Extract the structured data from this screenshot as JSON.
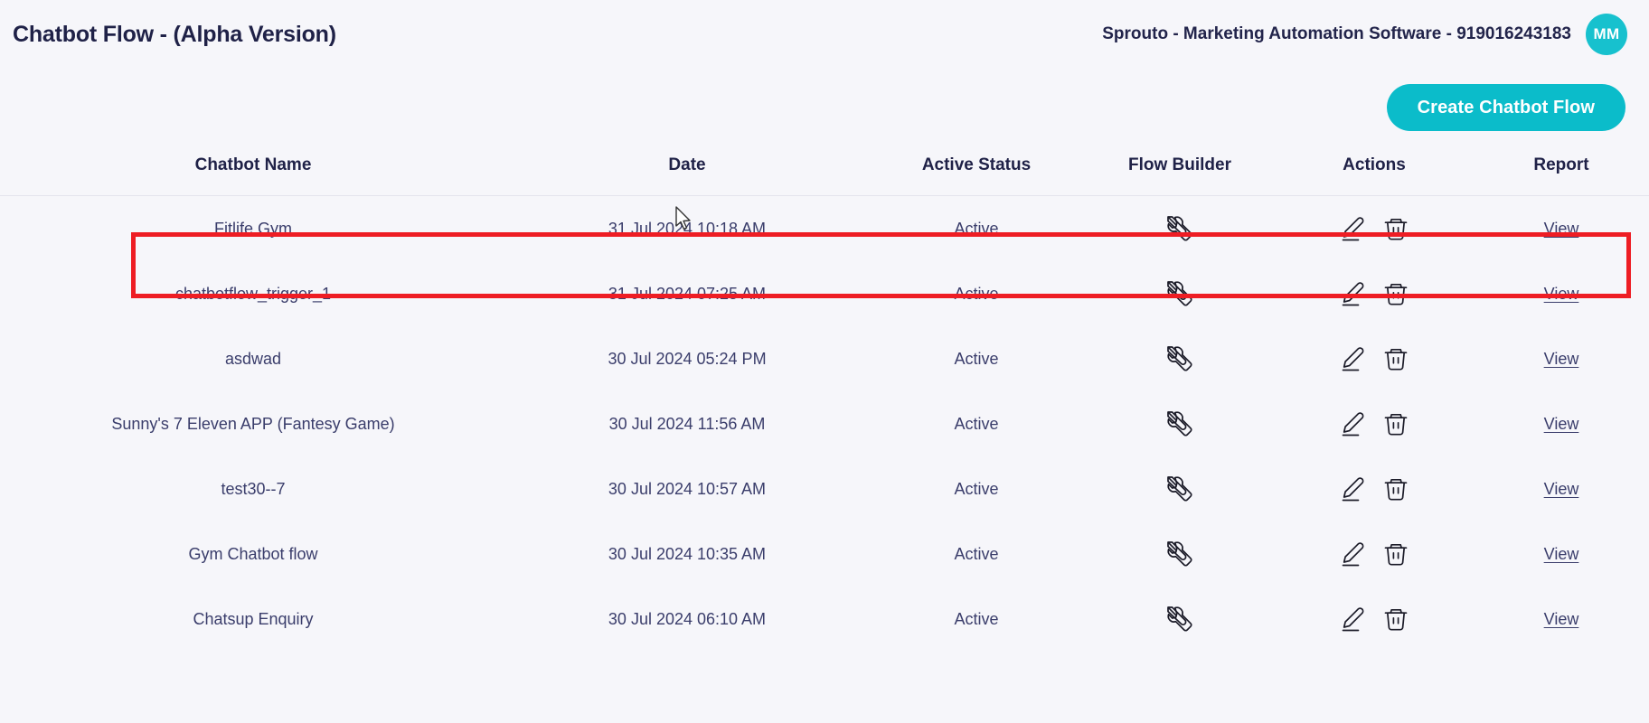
{
  "header": {
    "title": "Chatbot Flow - (Alpha Version)",
    "account_label": "Sprouto - Marketing Automation Software - 919016243183",
    "avatar_initials": "MM",
    "avatar_color": "#17c1ce"
  },
  "toolbar": {
    "create_label": "Create Chatbot Flow",
    "create_color": "#0bbcca"
  },
  "table": {
    "columns": [
      "Chatbot Name",
      "Date",
      "Active Status",
      "Flow Builder",
      "Actions",
      "Report"
    ],
    "icons": {
      "flow_builder": "tools-icon",
      "edit": "pencil-icon",
      "delete": "trash-icon"
    },
    "report_link_label": "View",
    "rows": [
      {
        "name": "Fitlife Gym",
        "date": "31 Jul 2024 10:18 AM",
        "status": "Active",
        "report": "View",
        "highlighted": true
      },
      {
        "name": "chatbotflow_trigger_1",
        "date": "31 Jul 2024 07:25 AM",
        "status": "Active",
        "report": "View",
        "highlighted": false
      },
      {
        "name": "asdwad",
        "date": "30 Jul 2024 05:24 PM",
        "status": "Active",
        "report": "View",
        "highlighted": false
      },
      {
        "name": "Sunny's 7 Eleven APP (Fantesy Game)",
        "date": "30 Jul 2024 11:56 AM",
        "status": "Active",
        "report": "View",
        "highlighted": false
      },
      {
        "name": "test30--7",
        "date": "30 Jul 2024 10:57 AM",
        "status": "Active",
        "report": "View",
        "highlighted": false
      },
      {
        "name": "Gym Chatbot flow",
        "date": "30 Jul 2024 10:35 AM",
        "status": "Active",
        "report": "View",
        "highlighted": false
      },
      {
        "name": "Chatsup Enquiry",
        "date": "30 Jul 2024 06:10 AM",
        "status": "Active",
        "report": "View",
        "highlighted": false
      }
    ]
  },
  "annotation": {
    "highlight_color": "#ee1d24"
  }
}
